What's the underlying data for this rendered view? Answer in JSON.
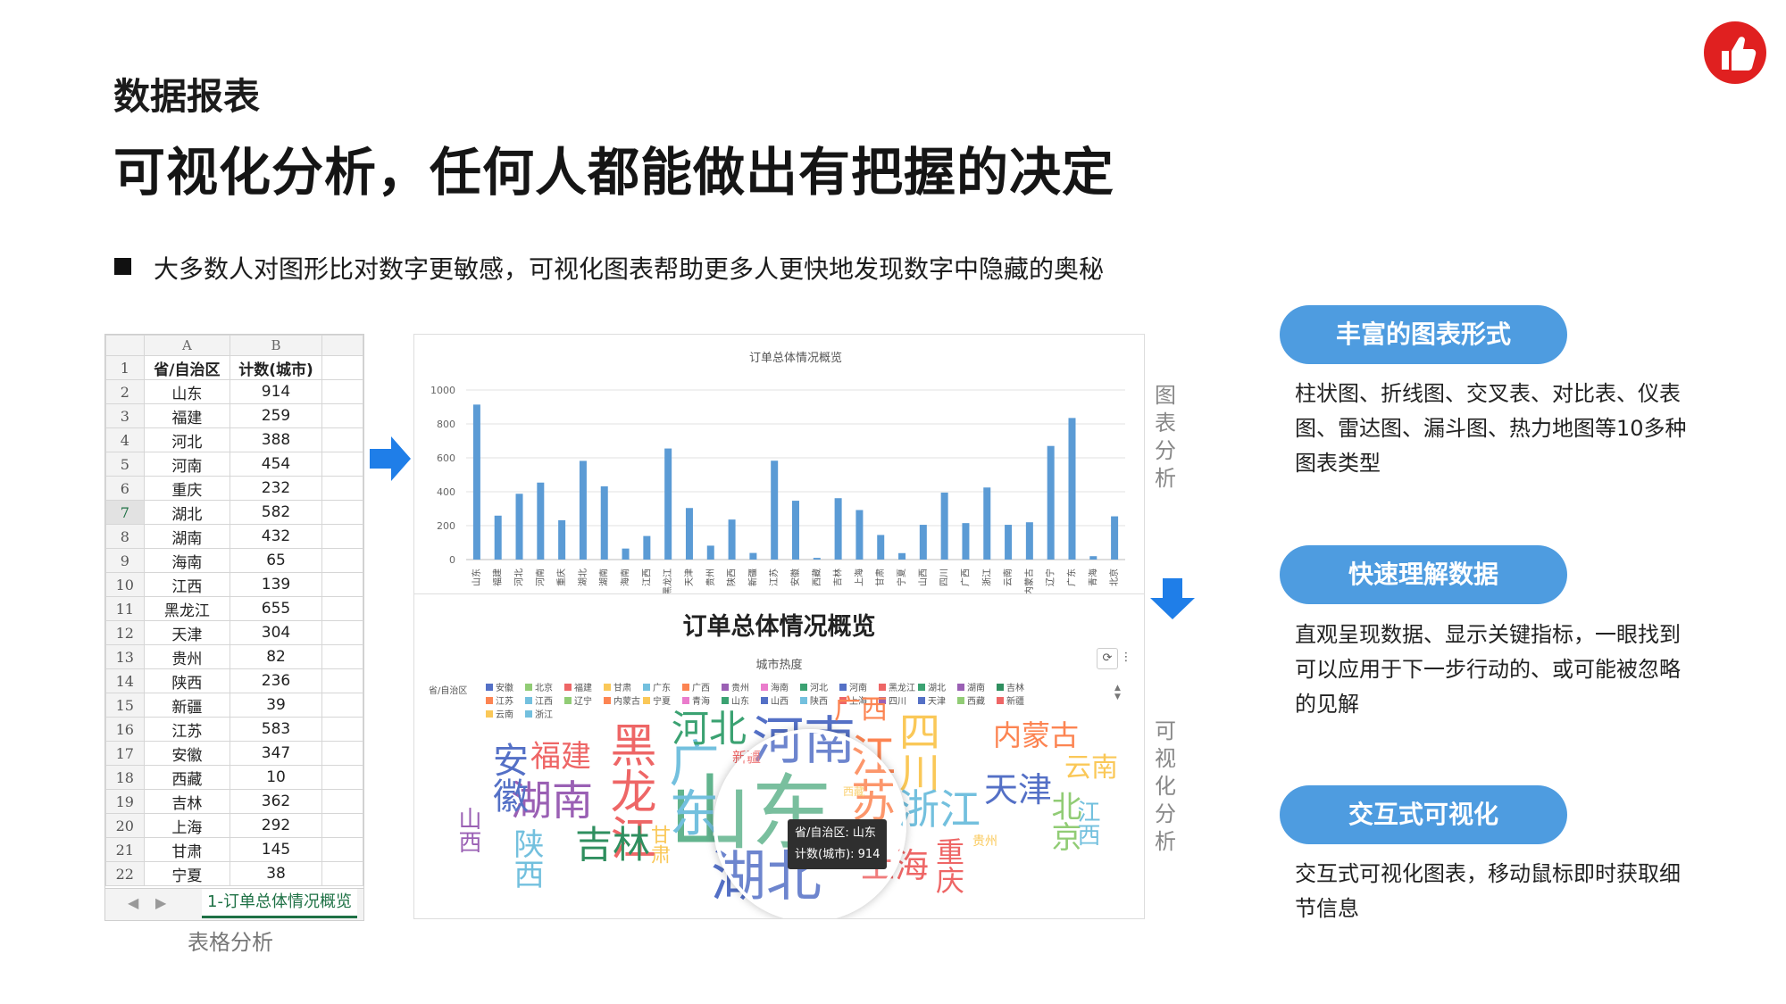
{
  "header": {
    "subtitle": "数据报表",
    "headline": "可视化分析，任何人都能做出有把握的决定",
    "bullet": "大多数人对图形比对数字更敏感，可视化图表帮助更多人更快地发现数字中隐藏的奥秘"
  },
  "badge": {
    "icon": "thumbs-up-icon",
    "color": "#e02020"
  },
  "spreadsheet": {
    "columns": [
      "A",
      "B"
    ],
    "header_row": {
      "province": "省/自治区",
      "count": "计数(城市)"
    },
    "rows": [
      {
        "n": "2",
        "province": "山东",
        "count": "914"
      },
      {
        "n": "3",
        "province": "福建",
        "count": "259"
      },
      {
        "n": "4",
        "province": "河北",
        "count": "388"
      },
      {
        "n": "5",
        "province": "河南",
        "count": "454"
      },
      {
        "n": "6",
        "province": "重庆",
        "count": "232"
      },
      {
        "n": "7",
        "province": "湖北",
        "count": "582"
      },
      {
        "n": "8",
        "province": "湖南",
        "count": "432"
      },
      {
        "n": "9",
        "province": "海南",
        "count": "65"
      },
      {
        "n": "10",
        "province": "江西",
        "count": "139"
      },
      {
        "n": "11",
        "province": "黑龙江",
        "count": "655"
      },
      {
        "n": "12",
        "province": "天津",
        "count": "304"
      },
      {
        "n": "13",
        "province": "贵州",
        "count": "82"
      },
      {
        "n": "14",
        "province": "陕西",
        "count": "236"
      },
      {
        "n": "15",
        "province": "新疆",
        "count": "39"
      },
      {
        "n": "16",
        "province": "江苏",
        "count": "583"
      },
      {
        "n": "17",
        "province": "安徽",
        "count": "347"
      },
      {
        "n": "18",
        "province": "西藏",
        "count": "10"
      },
      {
        "n": "19",
        "province": "吉林",
        "count": "362"
      },
      {
        "n": "20",
        "province": "上海",
        "count": "292"
      },
      {
        "n": "21",
        "province": "甘肃",
        "count": "145"
      },
      {
        "n": "22",
        "province": "宁夏",
        "count": "38"
      }
    ],
    "sheet_tab": "1-订单总体情况概览",
    "caption": "表格分析"
  },
  "bar_section_label": "图表分析",
  "cloud_section_label": "可视化分析",
  "chart_data": {
    "type": "bar",
    "title": "订单总体情况概览",
    "categories": [
      "山东",
      "福建",
      "河北",
      "河南",
      "重庆",
      "湖北",
      "湖南",
      "海南",
      "江西",
      "黑龙江",
      "天津",
      "贵州",
      "陕西",
      "新疆",
      "江苏",
      "安徽",
      "西藏",
      "吉林",
      "上海",
      "甘肃",
      "宁夏",
      "山西",
      "四川",
      "广西",
      "浙江",
      "云南",
      "内蒙古",
      "辽宁",
      "广东",
      "青海",
      "北京"
    ],
    "values": [
      914,
      259,
      388,
      454,
      232,
      582,
      432,
      65,
      139,
      655,
      304,
      82,
      236,
      39,
      583,
      347,
      10,
      362,
      292,
      145,
      38,
      205,
      395,
      215,
      425,
      205,
      220,
      670,
      835,
      20,
      255
    ],
    "ylim": [
      0,
      1000
    ],
    "yticks": [
      0,
      200,
      400,
      600,
      800,
      1000
    ],
    "grid": true,
    "color": "#5b9bd5"
  },
  "word_cloud": {
    "title": "订单总体情况概览",
    "subtitle": "城市热度",
    "legend_label": "省/自治区",
    "legend": [
      {
        "name": "安徽",
        "color": "#5470c6"
      },
      {
        "name": "北京",
        "color": "#91cc75"
      },
      {
        "name": "福建",
        "color": "#ee6666"
      },
      {
        "name": "甘肃",
        "color": "#fac858"
      },
      {
        "name": "广东",
        "color": "#73c0de"
      },
      {
        "name": "广西",
        "color": "#fc8452"
      },
      {
        "name": "贵州",
        "color": "#9a60b4"
      },
      {
        "name": "海南",
        "color": "#ea7ccc"
      },
      {
        "name": "河北",
        "color": "#3ba272"
      },
      {
        "name": "河南",
        "color": "#5470c6"
      },
      {
        "name": "黑龙江",
        "color": "#ee6666"
      },
      {
        "name": "湖北",
        "color": "#3ba272"
      },
      {
        "name": "湖南",
        "color": "#9a60b4"
      },
      {
        "name": "吉林",
        "color": "#2f8f5f"
      },
      {
        "name": "江苏",
        "color": "#fc8452"
      },
      {
        "name": "江西",
        "color": "#73c0de"
      },
      {
        "name": "辽宁",
        "color": "#91cc75"
      },
      {
        "name": "内蒙古",
        "color": "#fc8452"
      },
      {
        "name": "宁夏",
        "color": "#fac858"
      },
      {
        "name": "青海",
        "color": "#ea7ccc"
      },
      {
        "name": "山东",
        "color": "#3ba272"
      },
      {
        "name": "山西",
        "color": "#5470c6"
      },
      {
        "name": "陕西",
        "color": "#73c0de"
      },
      {
        "name": "上海",
        "color": "#ee6666"
      },
      {
        "name": "四川",
        "color": "#9a60b4"
      },
      {
        "name": "天津",
        "color": "#5470c6"
      },
      {
        "name": "西藏",
        "color": "#91cc75"
      },
      {
        "name": "新疆",
        "color": "#ee6666"
      },
      {
        "name": "云南",
        "color": "#fac858"
      },
      {
        "name": "浙江",
        "color": "#73c0de"
      }
    ],
    "words": [
      {
        "text": "山东",
        "color": "#3ba272"
      },
      {
        "text": "湖北",
        "color": "#5470c6"
      },
      {
        "text": "河南",
        "color": "#5470c6"
      },
      {
        "text": "黑龙江",
        "color": "#ee6666"
      },
      {
        "text": "广东",
        "color": "#73c0de"
      },
      {
        "text": "江苏",
        "color": "#fc8452"
      },
      {
        "text": "四川",
        "color": "#fac858"
      },
      {
        "text": "浙江",
        "color": "#73c0de"
      },
      {
        "text": "湖南",
        "color": "#9a60b4"
      },
      {
        "text": "河北",
        "color": "#3ba272"
      },
      {
        "text": "安徽",
        "color": "#5470c6"
      },
      {
        "text": "吉林",
        "color": "#2f8f5f"
      },
      {
        "text": "天津",
        "color": "#5470c6"
      },
      {
        "text": "上海",
        "color": "#ee6666"
      },
      {
        "text": "福建",
        "color": "#ee6666"
      },
      {
        "text": "陕西",
        "color": "#73c0de"
      },
      {
        "text": "内蒙古",
        "color": "#fc8452"
      },
      {
        "text": "北京",
        "color": "#91cc75"
      },
      {
        "text": "重庆",
        "color": "#ee6666"
      },
      {
        "text": "云南",
        "color": "#fac858"
      },
      {
        "text": "广西",
        "color": "#fc8452"
      },
      {
        "text": "江西",
        "color": "#73c0de"
      },
      {
        "text": "山西",
        "color": "#9a60b4"
      },
      {
        "text": "甘肃",
        "color": "#fac858"
      },
      {
        "text": "新疆",
        "color": "#ee6666"
      },
      {
        "text": "贵州",
        "color": "#fac858"
      },
      {
        "text": "西藏",
        "color": "#fac858"
      }
    ],
    "tooltip": {
      "line1": "省/自治区: 山东",
      "line2": "计数(城市): 914"
    },
    "toolbar_icons": [
      "refresh-icon",
      "more-icon"
    ]
  },
  "features": [
    {
      "title": "丰富的图表形式",
      "desc": "柱状图、折线图、交叉表、对比表、仪表图、雷达图、漏斗图、热力地图等10多种图表类型"
    },
    {
      "title": "快速理解数据",
      "desc": "直观呈现数据、显示关键指标，一眼找到可以应用于下一步行动的、或可能被忽略的见解"
    },
    {
      "title": "交互式可视化",
      "desc": "交互式可视化图表，移动鼠标即时获取细节信息"
    }
  ],
  "accent_color": "#4e9ce0"
}
